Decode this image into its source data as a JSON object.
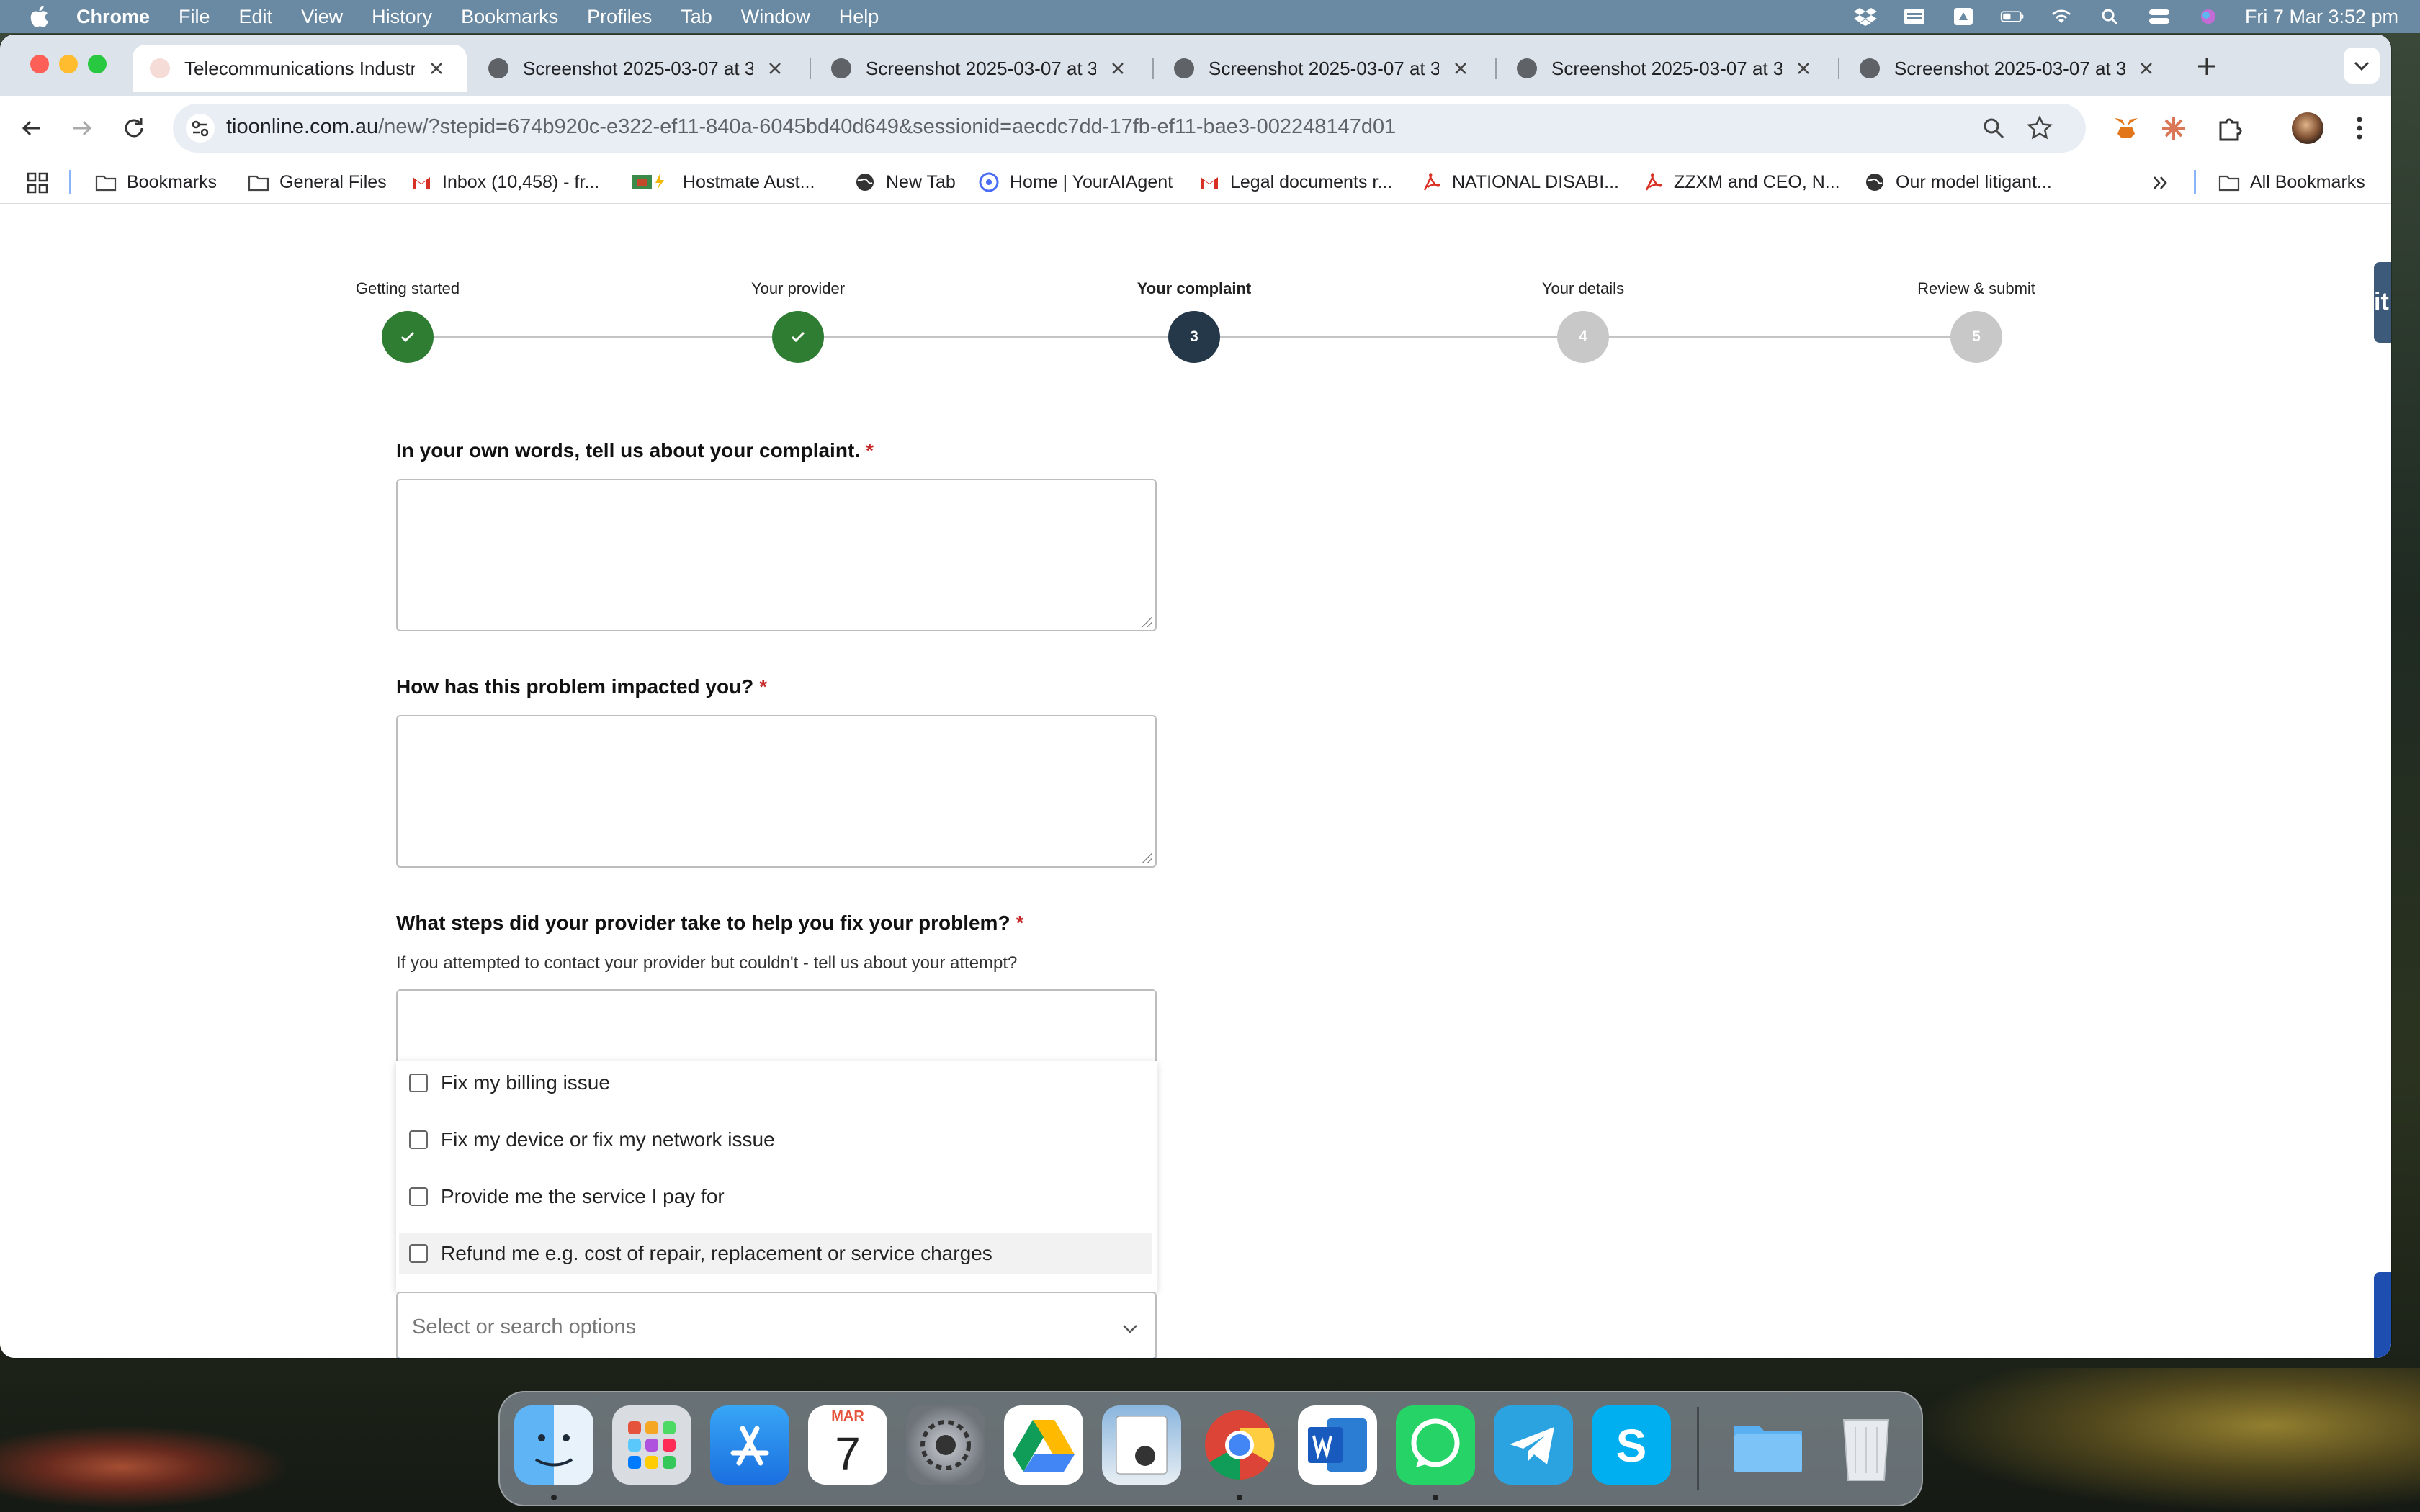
{
  "menubar": {
    "app_name": "Chrome",
    "items": [
      "File",
      "Edit",
      "View",
      "History",
      "Bookmarks",
      "Profiles",
      "Tab",
      "Window",
      "Help"
    ],
    "datetime": "Fri 7 Mar  3:52 pm"
  },
  "tabs": [
    {
      "title": "Telecommunications Industry",
      "active": true
    },
    {
      "title": "Screenshot 2025-03-07 at 3",
      "active": false
    },
    {
      "title": "Screenshot 2025-03-07 at 3",
      "active": false
    },
    {
      "title": "Screenshot 2025-03-07 at 3",
      "active": false
    },
    {
      "title": "Screenshot 2025-03-07 at 3",
      "active": false
    },
    {
      "title": "Screenshot 2025-03-07 at 3",
      "active": false
    }
  ],
  "omnibox": {
    "host": "tioonline.com.au",
    "path": "/new/?stepid=674b920c-e322-ef11-840a-6045bd40d649&sessionid=aecdc7dd-17fb-ef11-bae3-002248147d01"
  },
  "bookmarks": {
    "items": [
      {
        "label": "Bookmarks",
        "icon": "folder-icon"
      },
      {
        "label": "General Files",
        "icon": "folder-icon"
      },
      {
        "label": "Inbox (10,458) - fr...",
        "icon": "gmail-icon"
      },
      {
        "label": "Hostmate Aust...",
        "icon": "hostmate-icon"
      },
      {
        "label": "New Tab",
        "icon": "globe-icon"
      },
      {
        "label": "Home | YourAIAgent",
        "icon": "agent-icon"
      },
      {
        "label": "Legal documents r...",
        "icon": "gmail-icon"
      },
      {
        "label": "NATIONAL DISABI...",
        "icon": "pdf-icon"
      },
      {
        "label": "ZZXM and CEO, N...",
        "icon": "pdf-icon"
      },
      {
        "label": "Our model litigant...",
        "icon": "globe-icon"
      }
    ],
    "all_bookmarks": "All Bookmarks"
  },
  "stepper": {
    "steps": [
      {
        "label": "Getting started",
        "state": "done",
        "number": ""
      },
      {
        "label": "Your provider",
        "state": "done",
        "number": ""
      },
      {
        "label": "Your complaint",
        "state": "current",
        "number": "3"
      },
      {
        "label": "Your details",
        "state": "todo",
        "number": "4"
      },
      {
        "label": "Review & submit",
        "state": "todo",
        "number": "5"
      }
    ]
  },
  "form": {
    "q1": {
      "label": "In your own words, tell us about your complaint.",
      "required": "*",
      "value": ""
    },
    "q2": {
      "label": "How has this problem impacted you?",
      "required": "*",
      "value": ""
    },
    "q3": {
      "label": "What steps did your provider take to help you fix your problem?",
      "required": "*",
      "hint": "If you attempted to contact your provider but couldn't - tell us about your attempt?"
    },
    "options": [
      "Fix my billing issue",
      "Fix my device or fix my network issue",
      "Provide me the service I pay for",
      "Refund me e.g. cost of repair, replacement or service charges"
    ],
    "select_placeholder": "Select or search options"
  },
  "side_tab_text": "it",
  "dock": {
    "calendar_month": "MAR",
    "calendar_day": "7",
    "apps": [
      "finder",
      "launchpad",
      "app-store",
      "calendar",
      "system-settings",
      "google-drive",
      "preview",
      "chrome",
      "word",
      "whatsapp",
      "telegram",
      "skype",
      "folder",
      "trash"
    ]
  },
  "colors": {
    "done": "#2e7d32",
    "current": "#243849",
    "todo": "#c8c8c8",
    "required": "#c62828",
    "focus": "#1a73e8"
  }
}
